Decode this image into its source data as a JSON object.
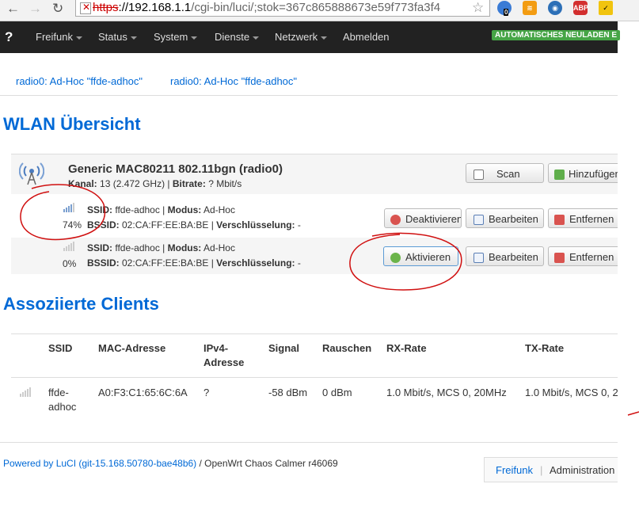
{
  "browser": {
    "url_scheme": "https",
    "url_host": "://192.168.1.1",
    "url_path": "/cgi-bin/luci/;stok=367c865888673e59f773fa3f4",
    "ext_badge_count": "0",
    "abp_label": "ABP"
  },
  "navbar": {
    "help": "?",
    "items": [
      "Freifunk",
      "Status",
      "System",
      "Dienste",
      "Netzwerk",
      "Abmelden"
    ],
    "autoreload": "AUTOMATISCHES NEULADEN E"
  },
  "tabs": [
    "radio0: Ad-Hoc \"ffde-adhoc\"",
    "radio0: Ad-Hoc \"ffde-adhoc\""
  ],
  "wlan": {
    "title": "WLAN Übersicht",
    "device": {
      "name": "Generic MAC80211 802.11bgn (radio0)",
      "channel_label": "Kanal:",
      "channel_value": " 13 (2.472 GHz) | ",
      "bitrate_label": "Bitrate:",
      "bitrate_value": " ? Mbit/s",
      "scan_button": "Scan",
      "add_button": "Hinzufügen"
    },
    "networks": [
      {
        "quality": "74%",
        "ssid_label": "SSID:",
        "ssid": " ffde-adhoc | ",
        "mode_label": "Modus:",
        "mode": " Ad-Hoc",
        "bssid_label": "BSSID:",
        "bssid": " 02:CA:FF:EE:BA:BE | ",
        "enc_label": "Verschlüsselung:",
        "enc": " -",
        "toggle_button": "Deaktivieren",
        "edit_button": "Bearbeiten",
        "remove_button": "Entfernen"
      },
      {
        "quality": "0%",
        "ssid_label": "SSID:",
        "ssid": " ffde-adhoc | ",
        "mode_label": "Modus:",
        "mode": " Ad-Hoc",
        "bssid_label": "BSSID:",
        "bssid": " 02:CA:FF:EE:BA:BE | ",
        "enc_label": "Verschlüsselung:",
        "enc": " -",
        "toggle_button": "Aktivieren",
        "edit_button": "Bearbeiten",
        "remove_button": "Entfernen"
      }
    ]
  },
  "clients": {
    "title": "Assoziierte Clients",
    "headers": [
      "SSID",
      "MAC-Adresse",
      "IPv4-Adresse",
      "Signal",
      "Rauschen",
      "RX-Rate",
      "TX-Rate"
    ],
    "ipv4_header_line1": "IPv4-",
    "ipv4_header_line2": "Adresse",
    "row": {
      "ssid_line1": "ffde-",
      "ssid_line2": "adhoc",
      "mac": "A0:F3:C1:65:6C:6A",
      "ipv4": "?",
      "signal": "-58 dBm",
      "noise": "0 dBm",
      "rx": "1.0 Mbit/s, MCS 0, 20MHz",
      "tx": "1.0 Mbit/s, MCS 0, 2"
    }
  },
  "footer": {
    "powered": "Powered by LuCI (git-15.168.50780-bae48b6)",
    "version": " / OpenWrt Chaos Calmer r46069",
    "links": [
      "Freifunk",
      "Administration"
    ]
  },
  "colors": {
    "link": "#0069d6",
    "navbar": "#222222",
    "autoreload": "#46a546",
    "annotation": "#d01010"
  }
}
